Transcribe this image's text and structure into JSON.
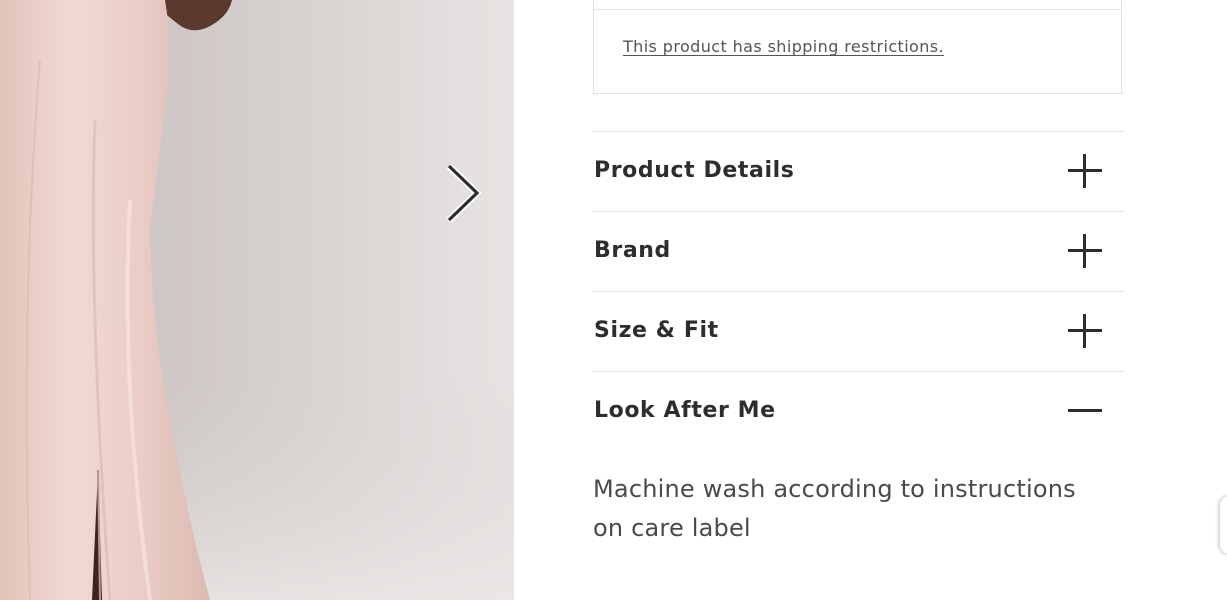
{
  "product": {
    "image_alt": "Model wearing a blush pink satin maxi dress with front slit",
    "gallery_next_icon": "chevron-right-icon"
  },
  "shipping": {
    "restriction_link": "This product has shipping restrictions."
  },
  "accordion": {
    "items": [
      {
        "title": "Product Details",
        "icon": "plus-icon",
        "expanded": false
      },
      {
        "title": "Brand",
        "icon": "plus-icon",
        "expanded": false
      },
      {
        "title": "Size & Fit",
        "icon": "plus-icon",
        "expanded": false
      },
      {
        "title": "Look After Me",
        "icon": "minus-icon",
        "expanded": true
      }
    ],
    "expanded_body": "Machine wash according to instructions on care label"
  },
  "colors": {
    "text_primary": "#2d2d2d",
    "divider": "#e2e2e2",
    "dress": "#eacfc9"
  }
}
